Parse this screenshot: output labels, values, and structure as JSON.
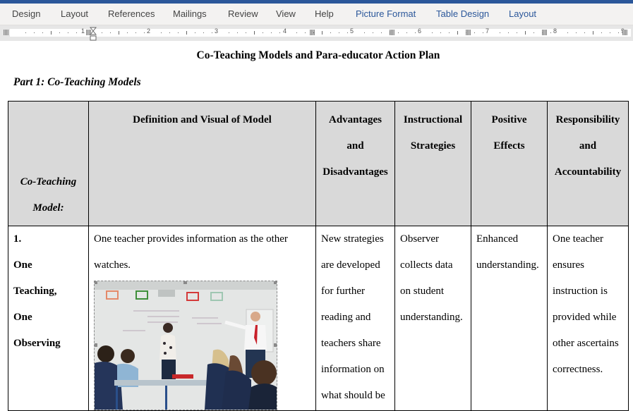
{
  "ribbon": {
    "tabs": [
      {
        "label": "Design",
        "contextual": false
      },
      {
        "label": "Layout",
        "contextual": false
      },
      {
        "label": "References",
        "contextual": false
      },
      {
        "label": "Mailings",
        "contextual": false
      },
      {
        "label": "Review",
        "contextual": false
      },
      {
        "label": "View",
        "contextual": false
      },
      {
        "label": "Help",
        "contextual": false
      },
      {
        "label": "Picture Format",
        "contextual": true
      },
      {
        "label": "Table Design",
        "contextual": true
      },
      {
        "label": "Layout",
        "contextual": true
      }
    ]
  },
  "ruler": {
    "numbers": [
      "1",
      "2",
      "3",
      "4",
      "5",
      "6",
      "7",
      "8",
      "9"
    ]
  },
  "document": {
    "title": "Co-Teaching Models and Para-educator Action Plan",
    "part_heading": "Part 1: Co-Teaching Models",
    "table": {
      "headers": [
        "Co-Teaching Model:",
        "Definition and Visual of Model",
        "Advantages and Disadvantages",
        "Instructional Strategies",
        "Positive Effects",
        "Responsibility and Accountability"
      ],
      "rows": [
        {
          "number": "1.",
          "model": "One Teaching, One Observing",
          "definition": "One teacher provides information as the other watches.",
          "image_alt": "Two teachers presenting at a whiteboard to students seated at tables",
          "advantages": "New strategies are developed for further reading and teachers share information on what should be",
          "strategies": "Observer collects data on student understanding.",
          "effects": "Enhanced understanding.",
          "responsibility": "One teacher ensures instruction is provided while other ascertains correctness."
        }
      ]
    }
  },
  "colors": {
    "title_bar": "#2b579a",
    "contextual_tab": "#2b579a",
    "header_fill": "#d9d9d9"
  }
}
